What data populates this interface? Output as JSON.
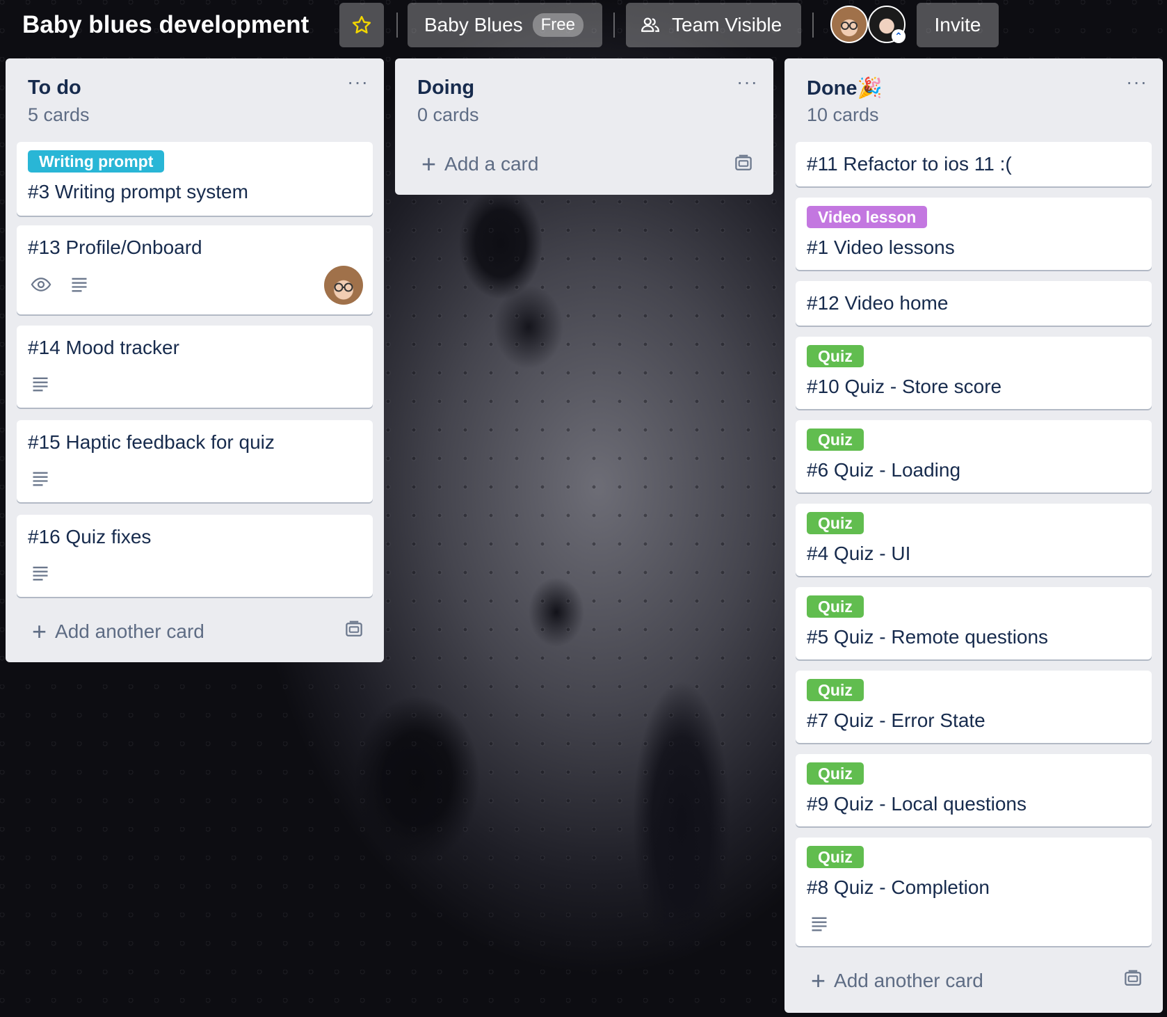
{
  "header": {
    "board_title": "Baby blues development",
    "workspace_name": "Baby Blues",
    "workspace_badge": "Free",
    "visibility_label": "Team Visible",
    "invite_label": "Invite"
  },
  "lists": [
    {
      "title": "To do",
      "count": "5 cards",
      "cards": [
        {
          "label": "Writing prompt",
          "title": "#3 Writing prompt system"
        },
        {
          "title": "#13 Profile/Onboard"
        },
        {
          "title": "#14 Mood tracker"
        },
        {
          "title": "#15 Haptic feedback for quiz"
        },
        {
          "title": "#16 Quiz fixes"
        }
      ],
      "add_label": "Add another card"
    },
    {
      "title": "Doing",
      "count": "0 cards",
      "add_label": "Add a card"
    },
    {
      "title": "Done🎉",
      "count": "10 cards",
      "cards": [
        {
          "title": "#11 Refactor to ios 11 :("
        },
        {
          "label": "Video lesson",
          "title": "#1 Video lessons"
        },
        {
          "title": "#12 Video home"
        },
        {
          "label": "Quiz",
          "title": "#10 Quiz - Store score"
        },
        {
          "label": "Quiz",
          "title": "#6 Quiz - Loading"
        },
        {
          "label": "Quiz",
          "title": "#4 Quiz - UI"
        },
        {
          "label": "Quiz",
          "title": "#5 Quiz - Remote questions"
        },
        {
          "label": "Quiz",
          "title": "#7 Quiz - Error State"
        },
        {
          "label": "Quiz",
          "title": "#9 Quiz - Local questions"
        },
        {
          "label": "Quiz",
          "title": "#8 Quiz - Completion"
        }
      ],
      "add_label": "Add another card"
    }
  ],
  "list_menu_glyph": "···",
  "add_glyph": "+",
  "colors": {
    "label_writing_prompt": "#29b6d6",
    "label_video_lesson": "#c377e0",
    "label_quiz": "#61bd4f",
    "list_bg": "#ebecf0",
    "text": "#172b4d",
    "muted": "#5e6c84"
  }
}
